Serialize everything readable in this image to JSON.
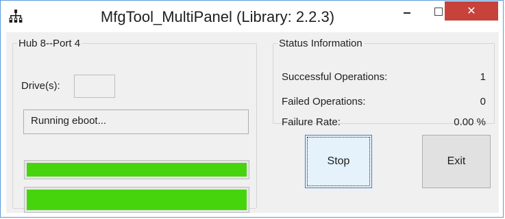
{
  "window": {
    "title": "MfgTool_MultiPanel (Library: 2.2.3)",
    "app_icon": "usb-hub-icon",
    "controls": {
      "minimize_icon": "minimize-icon",
      "maximize_icon": "maximize-icon",
      "close_icon": "close-icon",
      "close_glyph": "✕",
      "close_color": "#c7423b"
    }
  },
  "hub_panel": {
    "legend": "Hub 8--Port 4",
    "drive_label": "Drive(s):",
    "drive_value": "",
    "status_message": "Running eboot...",
    "progress_bars": [
      {
        "fill_fraction": 1.0,
        "color": "#46d50c"
      },
      {
        "fill_fraction": 1.0,
        "color": "#46d50c"
      }
    ]
  },
  "status_panel": {
    "legend": "Status Information",
    "rows": [
      {
        "label": "Successful Operations:",
        "value": "1"
      },
      {
        "label": "Failed Operations:",
        "value": "0"
      },
      {
        "label": "Failure Rate:",
        "value": "0.00 %"
      }
    ]
  },
  "buttons": {
    "stop_label": "Stop",
    "exit_label": "Exit"
  }
}
